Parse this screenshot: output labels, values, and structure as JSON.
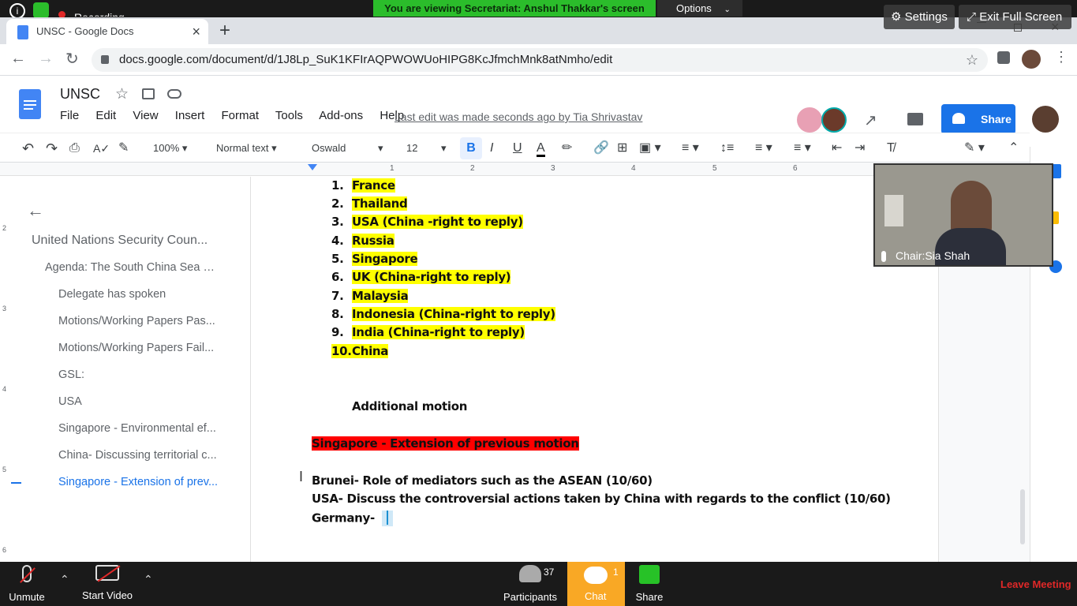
{
  "zoom": {
    "share_banner": "You are viewing Secretariat: Anshul Thakkar's screen",
    "options_label": "Options",
    "recording_label": "Recording",
    "settings_label": "Settings",
    "exit_fullscreen_label": "Exit Full Screen",
    "video_label": "Chair:Sia Shah",
    "bottom": {
      "unmute_label": "Unmute",
      "start_video_label": "Start Video",
      "participants_label": "Participants",
      "participants_count": "37",
      "chat_label": "Chat",
      "chat_badge": "1",
      "share_label": "Share",
      "leave_label": "Leave Meeting"
    },
    "colors": {
      "banner": "#2bbd2b",
      "chat": "#f9a825",
      "leave": "#e02828",
      "share": "#27c227"
    }
  },
  "browser": {
    "tab_title": "UNSC - Google Docs",
    "url": "docs.google.com/document/d/1J8Lp_SuK1KFIrAQPWOWUoHIPG8KcJfmchMnk8atNmho/edit"
  },
  "docs": {
    "title": "UNSC",
    "menu": [
      "File",
      "Edit",
      "View",
      "Insert",
      "Format",
      "Tools",
      "Add-ons",
      "Help"
    ],
    "last_edit": "Last edit was made seconds ago by Tia Shrivastav",
    "share_label": "Share",
    "toolbar": {
      "zoom": "100%",
      "style": "Normal text",
      "font": "Oswald",
      "size": "12"
    },
    "ruler_marks": [
      "1",
      "2",
      "3",
      "4",
      "5",
      "6"
    ],
    "margin_marks": [
      "2",
      "3",
      "4",
      "5",
      "6"
    ]
  },
  "outline": {
    "title": "United Nations Security Coun...",
    "items": [
      "Agenda: The South China Sea C...",
      "Delegate has spoken",
      "Motions/Working Papers Pas...",
      "Motions/Working Papers Fail...",
      "GSL:",
      "USA",
      "Singapore - Environmental ef...",
      "China- Discussing territorial c...",
      "Singapore - Extension of prev..."
    ]
  },
  "document": {
    "speakers": [
      {
        "n": "1.",
        "text": "France"
      },
      {
        "n": "2.",
        "text": "Thailand"
      },
      {
        "n": "3.",
        "text": "USA (China -right to reply)"
      },
      {
        "n": "4.",
        "text": "Russia"
      },
      {
        "n": "5.",
        "text": "Singapore"
      },
      {
        "n": "6.",
        "text": "UK (China-right to reply)"
      },
      {
        "n": "7.",
        "text": "Malaysia"
      },
      {
        "n": "8.",
        "text": "Indonesia (China-right to reply)"
      },
      {
        "n": "9.",
        "text": "India (China-right to reply)"
      },
      {
        "n": "10.",
        "text": "China"
      }
    ],
    "additional_motion": "Additional motion",
    "motion_heading": "Singapore - Extension of previous motion",
    "lines": [
      "Brunei- Role of mediators such as the ASEAN (10/60)",
      "USA- Discuss the controversial actions taken by China with regards to the conflict (10/60)",
      "Germany-"
    ]
  }
}
